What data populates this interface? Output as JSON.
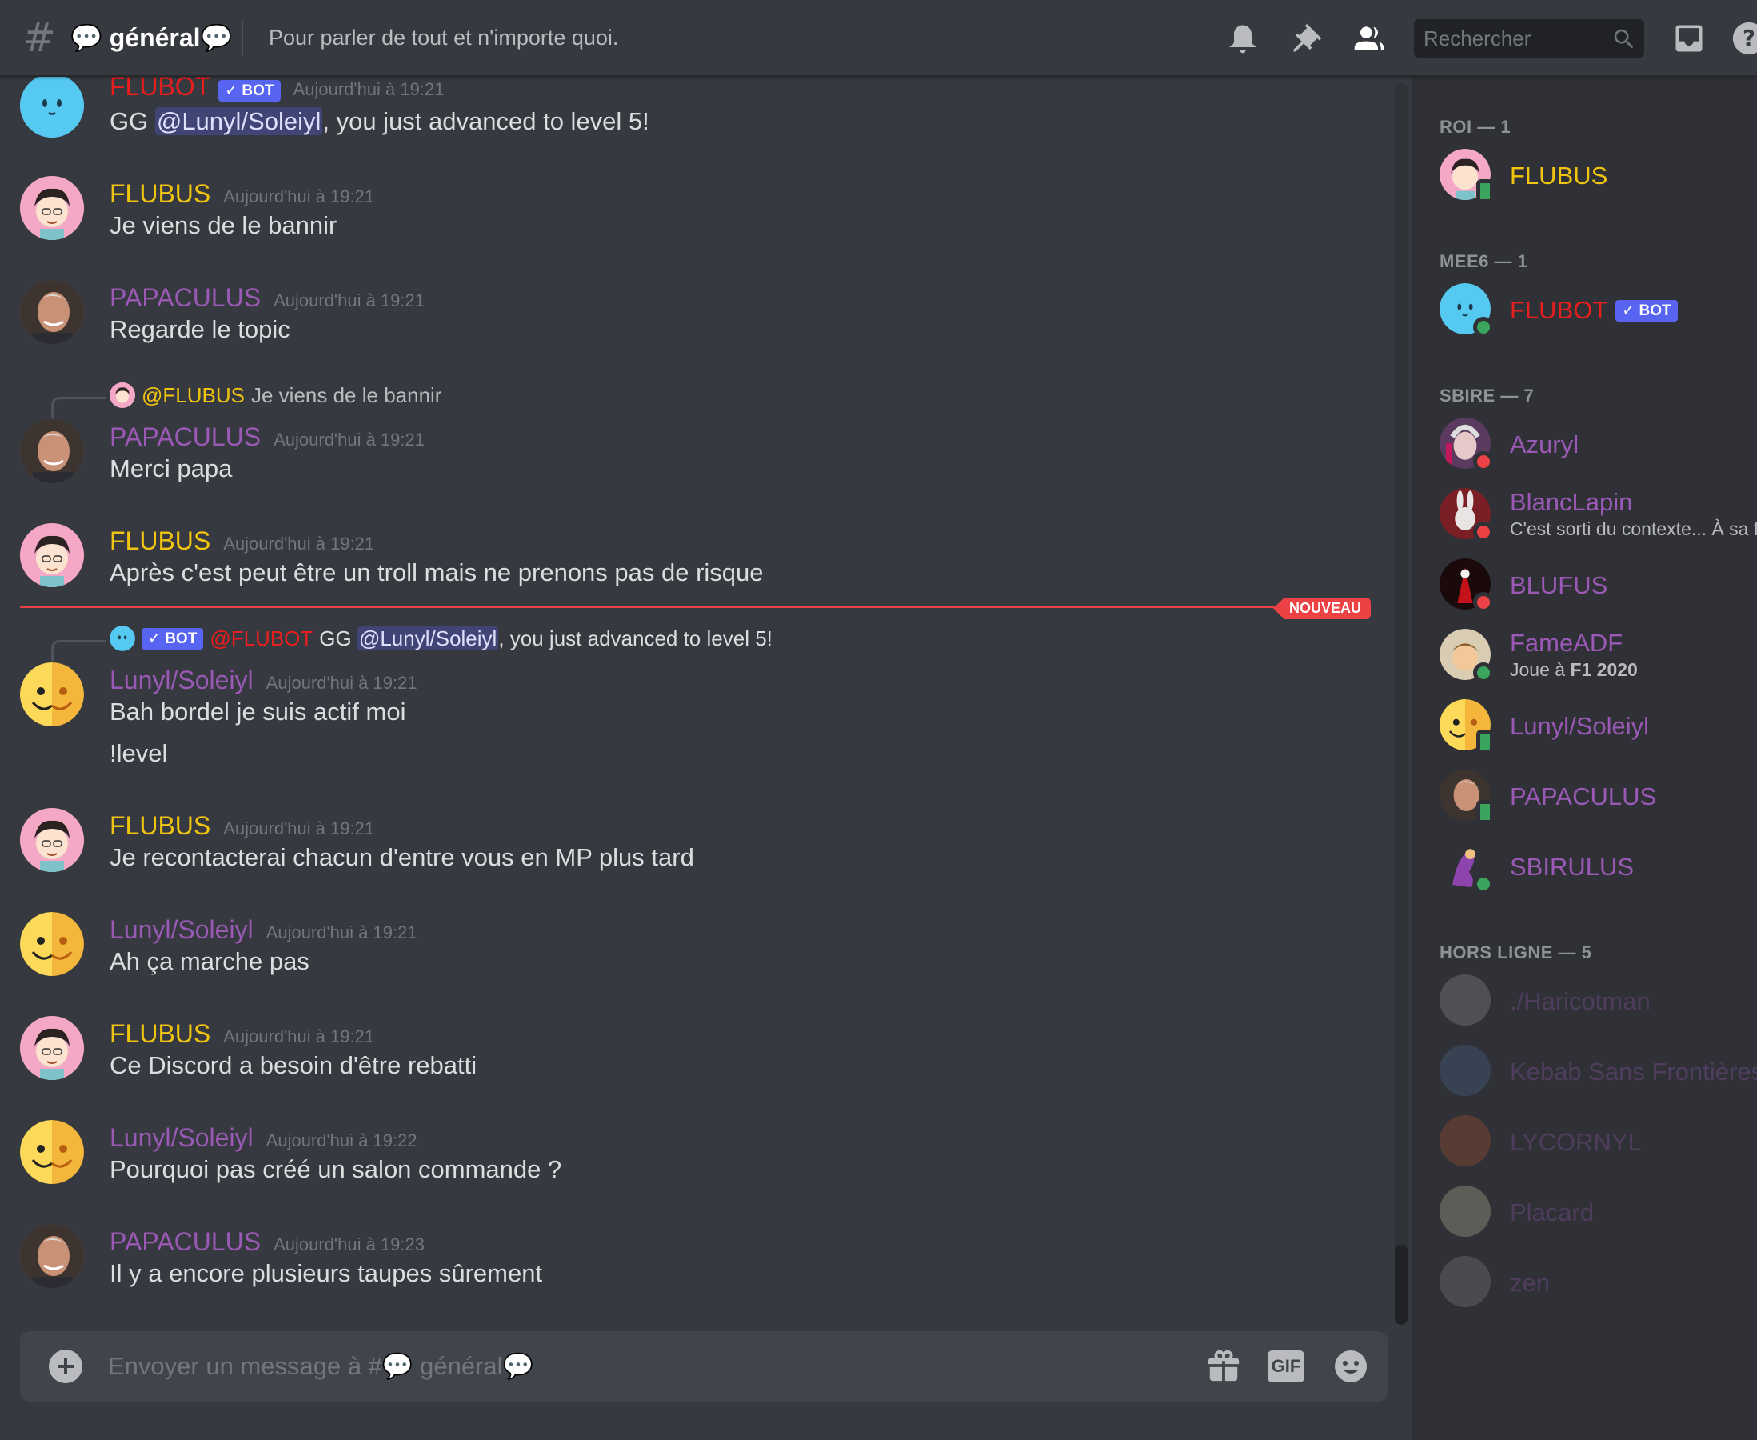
{
  "header": {
    "channel_name": "💬 général💬",
    "topic": "Pour parler de tout et n'importe quoi.",
    "search_placeholder": "Rechercher"
  },
  "messages": [
    {
      "author": "FLUBOT",
      "bot_label": "✓ BOT",
      "time": "Aujourd'hui à 19:21",
      "text_pre": "GG ",
      "mention": "@Lunyl/Soleiyl",
      "text_post": ", you just advanced to level 5!"
    },
    {
      "author": "FLUBUS",
      "time": "Aujourd'hui à 19:21",
      "text": "Je viens de le bannir"
    },
    {
      "author": "PAPACULUS",
      "time": "Aujourd'hui à 19:21",
      "text": "Regarde le topic"
    },
    {
      "reply_author": "@FLUBUS",
      "reply_text": "Je viens de le bannir",
      "author": "PAPACULUS",
      "time": "Aujourd'hui à 19:21",
      "text": "Merci papa"
    },
    {
      "author": "FLUBUS",
      "time": "Aujourd'hui à 19:21",
      "text": "Après c'est peut être un troll mais ne prenons pas de risque"
    },
    {
      "reply_bot_label": "✓ BOT",
      "reply_author": "@FLUBOT",
      "reply_text_pre": "GG ",
      "reply_mention": "@Lunyl/Soleiyl",
      "reply_text_post": ", you just advanced to level 5!",
      "author": "Lunyl/Soleiyl",
      "time": "Aujourd'hui à 19:21",
      "text": "Bah bordel je suis actif moi",
      "text2": "!level"
    },
    {
      "author": "FLUBUS",
      "time": "Aujourd'hui à 19:21",
      "text": "Je recontacterai chacun d'entre vous en MP plus tard"
    },
    {
      "author": "Lunyl/Soleiyl",
      "time": "Aujourd'hui à 19:21",
      "text": "Ah ça marche pas"
    },
    {
      "author": "FLUBUS",
      "time": "Aujourd'hui à 19:21",
      "text": "Ce Discord a besoin d'être rebatti"
    },
    {
      "author": "Lunyl/Soleiyl",
      "time": "Aujourd'hui à 19:22",
      "text": "Pourquoi pas créé un salon commande ?"
    },
    {
      "author": "PAPACULUS",
      "time": "Aujourd'hui à 19:23",
      "text": "Il y a encore plusieurs taupes sûrement"
    }
  ],
  "new_badge": "NOUVEAU",
  "composer": {
    "placeholder": "Envoyer un message à #💬 général💬",
    "gif_label": "GIF"
  },
  "members": {
    "roles": [
      {
        "label": "ROI — 1"
      },
      {
        "label": "MEE6 — 1"
      },
      {
        "label": "SBIRE — 7"
      },
      {
        "label": "HORS LIGNE — 5"
      }
    ],
    "list": [
      {
        "name": "FLUBUS",
        "sub": ""
      },
      {
        "name": "FLUBOT",
        "bot_label": "✓ BOT"
      },
      {
        "name": "Azuryl"
      },
      {
        "name": "BlancLapin",
        "sub": "C'est sorti du contexte... À sa f..."
      },
      {
        "name": "BLUFUS"
      },
      {
        "name": "FameADF",
        "sub_pre": "Joue à ",
        "sub_game": "F1 2020"
      },
      {
        "name": "Lunyl/Soleiyl"
      },
      {
        "name": "PAPACULUS"
      },
      {
        "name": "SBIRULUS"
      },
      {
        "name": "./Haricotman"
      },
      {
        "name": "Kebab Sans Frontières"
      },
      {
        "name": "LYCORNYL"
      },
      {
        "name": "Placard"
      },
      {
        "name": "zen"
      }
    ]
  },
  "colors": {
    "flubus": "#f1c40f",
    "papaculus": "#9b59b6",
    "flubot": "#e91e1e",
    "lunyl": "#9b59b6",
    "online": "#3ba55d",
    "dnd": "#ed4245",
    "bot_badge": "#5865f2"
  }
}
